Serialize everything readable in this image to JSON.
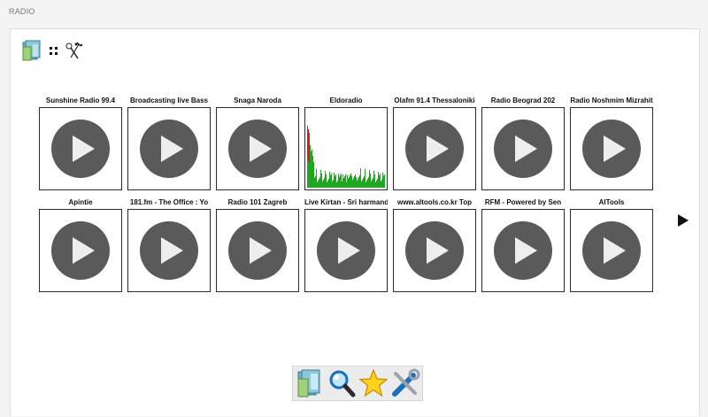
{
  "app": {
    "title": "RADIO"
  },
  "toolbar": {
    "icons": [
      "folder-icon",
      "grid-view-icon",
      "tools-icon"
    ]
  },
  "stations": [
    {
      "name": "Sunshine Radio 99.4",
      "state": "stopped"
    },
    {
      "name": "Broadcasting live Bass",
      "state": "stopped"
    },
    {
      "name": "Snaga Naroda",
      "state": "stopped"
    },
    {
      "name": "Eldoradio",
      "state": "playing"
    },
    {
      "name": "Olafm 91.4 Thessaloniki",
      "state": "stopped"
    },
    {
      "name": "Radio Beograd 202",
      "state": "stopped"
    },
    {
      "name": "Radio Noshmim Mizrahit",
      "state": "stopped"
    },
    {
      "name": "Apintie",
      "state": "stopped"
    },
    {
      "name": "181.fm - The Office : Yo",
      "state": "stopped"
    },
    {
      "name": "Radio 101 Zagreb",
      "state": "stopped"
    },
    {
      "name": "Live Kirtan - Sri harmandir",
      "state": "stopped"
    },
    {
      "name": "www.altools.co.kr Top",
      "state": "stopped"
    },
    {
      "name": "RFM - Powered by Sen",
      "state": "stopped"
    },
    {
      "name": "AlTools",
      "state": "stopped"
    }
  ],
  "navigation": {
    "next_icon": "next-page-arrow-icon"
  },
  "bottom_bar": {
    "buttons": [
      "library-icon",
      "search-icon",
      "favorites-star-icon",
      "settings-tools-icon"
    ]
  },
  "colors": {
    "play_circle": "#5a5a5a",
    "play_triangle": "#eeeeee",
    "visualizer_green": "#1fa81f",
    "visualizer_red": "#e01818"
  }
}
